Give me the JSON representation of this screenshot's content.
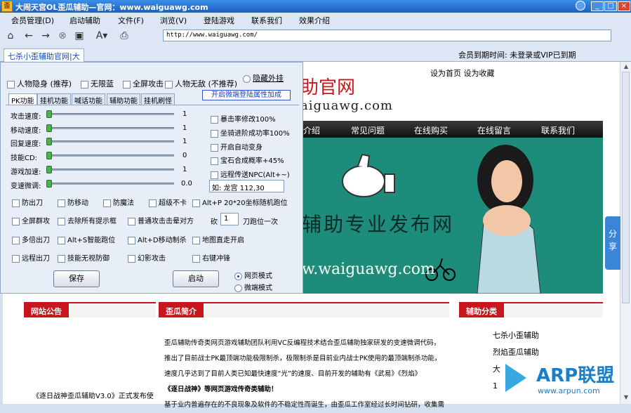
{
  "window": {
    "title": "大闹天宫OL歪瓜辅助—官网：www.waiguawg.com",
    "app_icon": "歪"
  },
  "menu": [
    "会员管理(D)",
    "启动辅助",
    "文件(F)",
    "浏览(V)",
    "登陆游戏",
    "联系我们",
    "效果介绍"
  ],
  "address": "http://www.waiguawg.com/",
  "tab_label": "七杀小歪辅助官网|大",
  "member_status": "会员到期时间:    未登录或VIP已到期",
  "panel": {
    "top_options": [
      "人物隐身 (推荐)",
      "无限蓝",
      "全屏攻击",
      "人物无敌 (不推荐)"
    ],
    "hide_plugin": "隐藏外挂",
    "tabs": [
      "PK功能",
      "挂机功能",
      "喊话功能",
      "辅助功能",
      "挂机刷怪"
    ],
    "attr_link": "开启微端登陆属性加成",
    "sliders": [
      {
        "label": "攻击速度:",
        "value": "1"
      },
      {
        "label": "移动速度:",
        "value": "1"
      },
      {
        "label": "回复速度:",
        "value": "1"
      },
      {
        "label": "技能CD:",
        "value": "0"
      },
      {
        "label": "游戏加速:",
        "value": "1"
      },
      {
        "label": "变速微调:",
        "value": "0.0"
      }
    ],
    "right_options": [
      "暴击率修改100%",
      "坐骑进阶成功率100%",
      "开启自动变身",
      "宝石合成概率+45%",
      "远程传送NPC(Alt+~)"
    ],
    "teleport_input": "如: 龙宫 112,30",
    "grid": [
      [
        "防出刀",
        "防移动",
        "防魔法",
        "超级不卡",
        "Alt+P 20*20坐标随机跑位"
      ],
      [
        "全屏群攻",
        "去除所有提示框",
        "普通攻击击晕对方",
        "砍",
        "刀跑位一次"
      ],
      [
        "多倍出刀",
        "Alt+S智能跑位",
        "Alt+D移动制杀",
        "地图直走开启"
      ],
      [
        "远程出刀",
        "技能无视防御",
        "幻影攻击",
        "右键冲锋"
      ]
    ],
    "chop_count": "1",
    "save_button": "保存",
    "start_button": "启动",
    "mode_options": [
      "网页模式",
      "微端模式"
    ]
  },
  "site": {
    "links": "设为首页  设为收藏",
    "title": "助官网",
    "url": "aiguawg.com",
    "nav": [
      "介绍",
      "常见问题",
      "在线购买",
      "在线留言",
      "联系我们"
    ],
    "banner_text": "辅助专业发布网",
    "banner_url": "w.waiguawg.com",
    "share": "分享",
    "notice_title": "网站公告",
    "notice_item": "《逐日战神歪瓜辅助V3.0》正式发布使",
    "intro_title": "歪瓜简介",
    "intro_lines": [
      "歪瓜辅助传奇类网页游戏辅助团队利用VC反编程技术结合歪瓜辅助独家研发的变速微调代码，",
      "推出了目前战士PK最顶端功能极限制杀，极限制杀是目前业内战士PK使用的最顶端制杀功能，",
      "速度几乎达到了目前人类已知最快速度“光”的速度、目前开发的辅助有《武易》《烈焰》",
      "《逐日战神》等网页游戏传奇类辅助！",
      "基于业内普遍存在的不良现象及软件的不稳定性而诞生，由歪瓜工作室经过长时间钻研，收集需"
    ],
    "category_title": "辅助分类",
    "categories": [
      "七杀小歪辅助",
      "烈焰歪瓜辅助",
      "大",
      "1"
    ],
    "watermark": "ARP联盟",
    "watermark_url": "www.arpun.com"
  },
  "colors": {
    "brand_red": "#c8161d",
    "banner_teal": "#1e8c7a"
  }
}
